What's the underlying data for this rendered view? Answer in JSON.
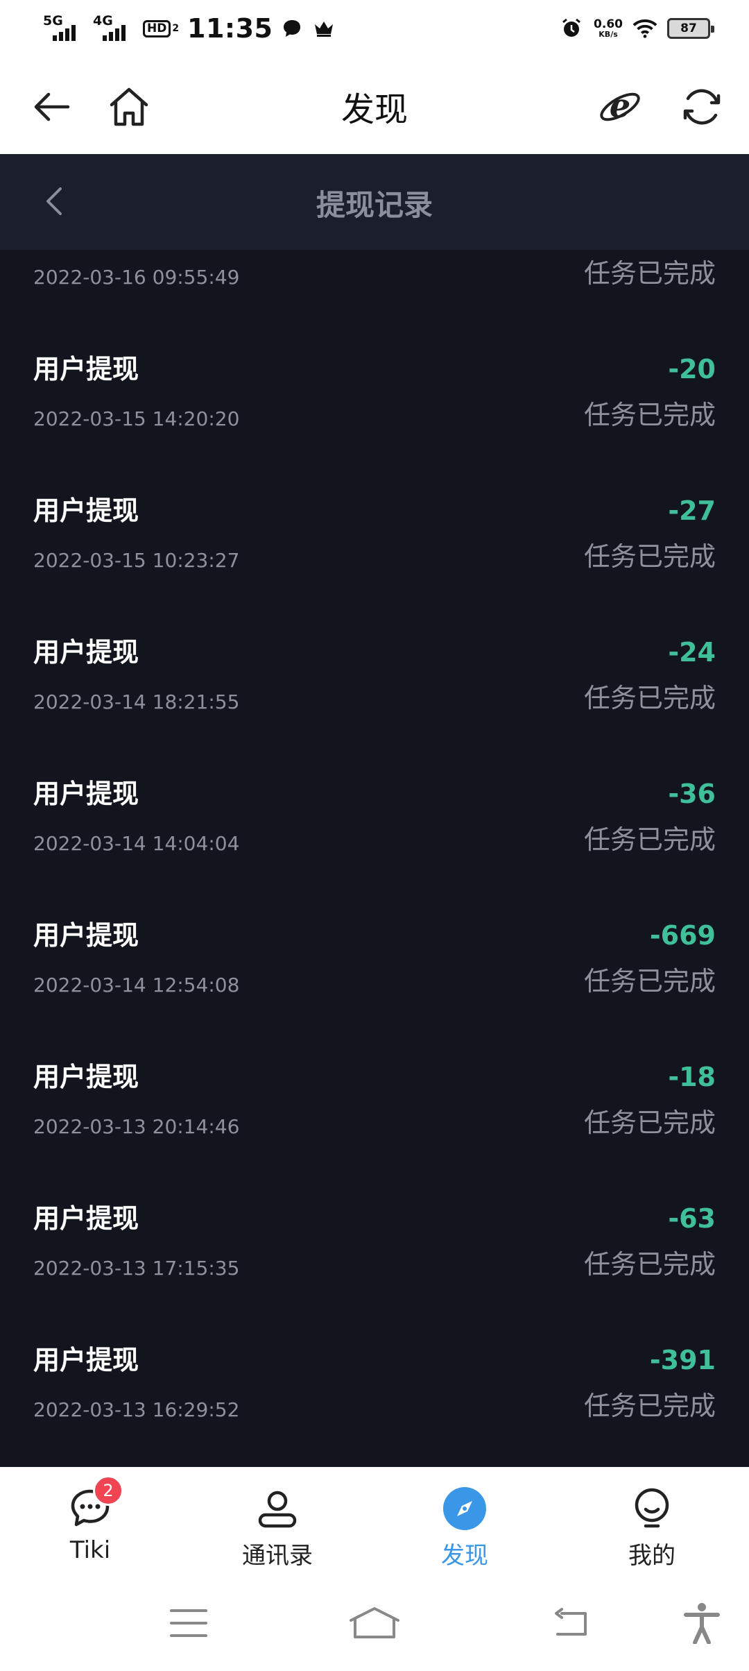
{
  "status_bar": {
    "network1": "5G",
    "network2": "4G",
    "hd_label": "HD",
    "hd_sub": "2",
    "time": "11:35",
    "speed_value": "0.60",
    "speed_unit": "KB/s",
    "battery": "87"
  },
  "app_header": {
    "title": "发现"
  },
  "page": {
    "title": "提现记录",
    "partial_row": {
      "date": "2022-03-16 09:55:49",
      "status": "任务已完成"
    },
    "records": [
      {
        "name": "用户提现",
        "amount": "-20",
        "date": "2022-03-15 14:20:20",
        "status": "任务已完成"
      },
      {
        "name": "用户提现",
        "amount": "-27",
        "date": "2022-03-15 10:23:27",
        "status": "任务已完成"
      },
      {
        "name": "用户提现",
        "amount": "-24",
        "date": "2022-03-14 18:21:55",
        "status": "任务已完成"
      },
      {
        "name": "用户提现",
        "amount": "-36",
        "date": "2022-03-14 14:04:04",
        "status": "任务已完成"
      },
      {
        "name": "用户提现",
        "amount": "-669",
        "date": "2022-03-14 12:54:08",
        "status": "任务已完成"
      },
      {
        "name": "用户提现",
        "amount": "-18",
        "date": "2022-03-13 20:14:46",
        "status": "任务已完成"
      },
      {
        "name": "用户提现",
        "amount": "-63",
        "date": "2022-03-13 17:15:35",
        "status": "任务已完成"
      },
      {
        "name": "用户提现",
        "amount": "-391",
        "date": "2022-03-13 16:29:52",
        "status": "任务已完成"
      }
    ]
  },
  "tabs": [
    {
      "label": "Tiki",
      "icon": "chat-bubble-icon",
      "badge": "2",
      "active": false
    },
    {
      "label": "通讯录",
      "icon": "contacts-person-icon",
      "active": false
    },
    {
      "label": "发现",
      "icon": "compass-icon",
      "active": true
    },
    {
      "label": "我的",
      "icon": "profile-face-icon",
      "active": false
    }
  ],
  "colors": {
    "page_bg": "#13151e",
    "subbar_bg": "#1b1f2b",
    "amount_green": "#3fc09a",
    "muted_text": "#8d919c",
    "active_tab": "#3a97e8",
    "badge_red": "#f04452"
  }
}
